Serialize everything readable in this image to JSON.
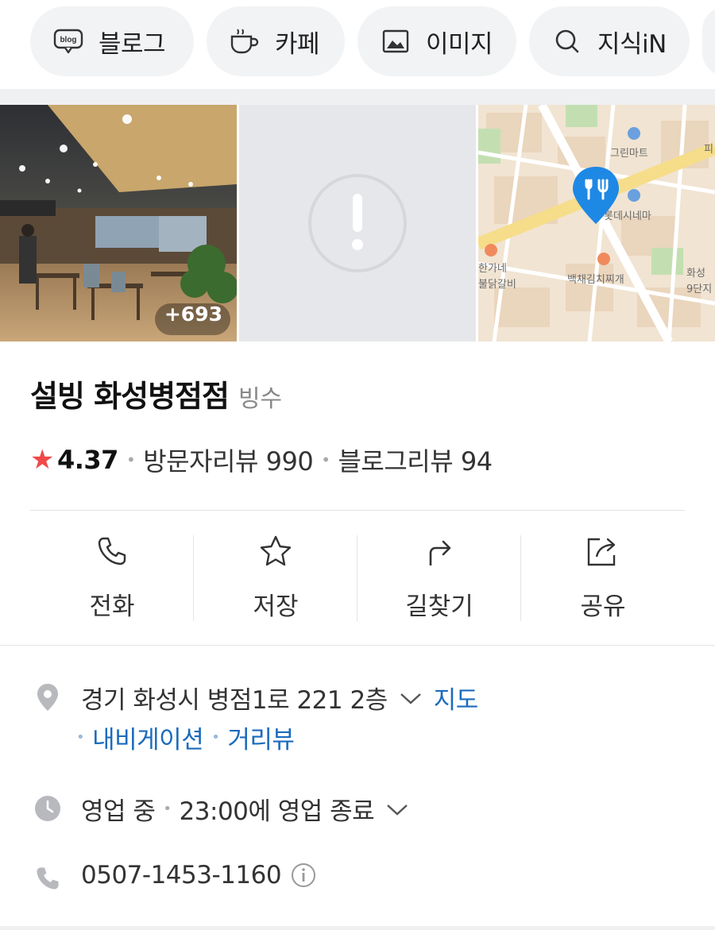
{
  "tabs": [
    {
      "icon": "blog-icon",
      "label": "블로그"
    },
    {
      "icon": "cafe-icon",
      "label": "카페"
    },
    {
      "icon": "image-icon",
      "label": "이미지"
    },
    {
      "icon": "search-icon",
      "label": "지식iN"
    }
  ],
  "photos": {
    "more_count": "+693"
  },
  "map": {
    "labels": [
      "그린마트",
      "롯데시네마",
      "한가네",
      "불닭갈비",
      "백채김치찌개",
      "화성",
      "9단지",
      "피"
    ]
  },
  "place": {
    "name": "설빙 화성병점점",
    "category": "빙수",
    "rating": "4.37",
    "visitor_reviews": "방문자리뷰 990",
    "blog_reviews": "블로그리뷰 94"
  },
  "actions": [
    {
      "icon": "phone-icon",
      "label": "전화"
    },
    {
      "icon": "star-icon",
      "label": "저장"
    },
    {
      "icon": "directions-icon",
      "label": "길찾기"
    },
    {
      "icon": "share-icon",
      "label": "공유"
    }
  ],
  "info": {
    "address": "경기 화성시 병점1로 221 2층",
    "map_link": "지도",
    "navigation_link": "내비게이션",
    "street_view_link": "거리뷰",
    "status": "영업 중",
    "hours": "23:00에 영업 종료",
    "phone": "0507-1453-1160"
  },
  "colors": {
    "accent_link": "#1b6bbd",
    "rating_star": "#f04848",
    "map_pin": "#1e88e5"
  }
}
